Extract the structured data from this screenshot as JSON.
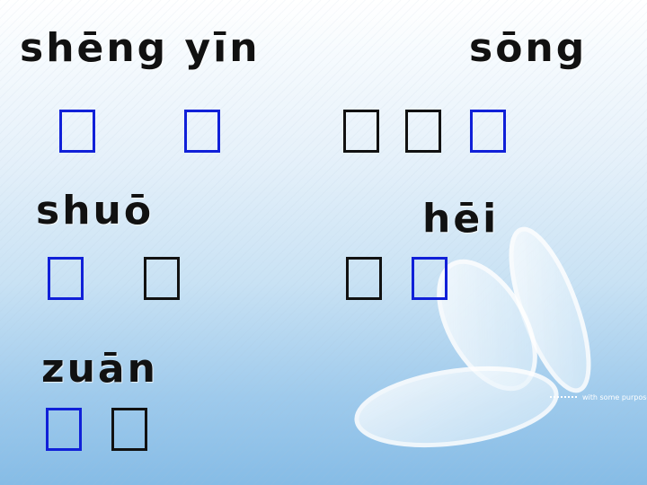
{
  "pinyin": {
    "sheng_yin": "shēng yīn",
    "song": "sōng",
    "shuo": "shuō",
    "hei": "hēi",
    "zuan": "zuān"
  },
  "background": {
    "tagline": "with some purpose",
    "colors": {
      "top": "#ffffff",
      "bottom": "#86bce6",
      "petal": "#ffffff"
    }
  },
  "box_colors": {
    "blue": "#1020d8",
    "black": "#111111"
  }
}
